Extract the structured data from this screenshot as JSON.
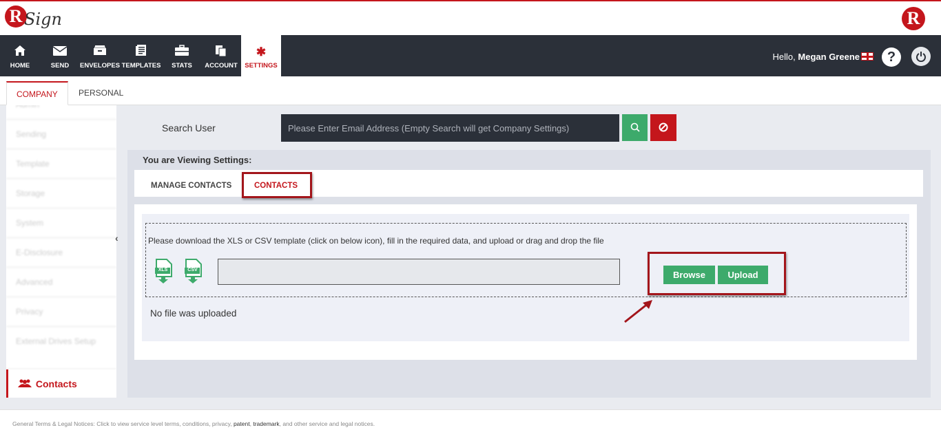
{
  "brand": {
    "logo_letter": "R",
    "logo_text": "Sign",
    "logo_right_letter": "R"
  },
  "nav": {
    "items": [
      {
        "label": "HOME",
        "icon": "home-icon"
      },
      {
        "label": "SEND",
        "icon": "envelope-icon"
      },
      {
        "label": "ENVELOPES",
        "icon": "inbox-icon"
      },
      {
        "label": "TEMPLATES",
        "icon": "document-icon"
      },
      {
        "label": "STATS",
        "icon": "briefcase-icon"
      },
      {
        "label": "ACCOUNT",
        "icon": "files-icon"
      },
      {
        "label": "SETTINGS",
        "icon": "gear-icon"
      }
    ],
    "active": "SETTINGS",
    "greeting": "Hello,",
    "user_name": "Megan Greene",
    "help_glyph": "?"
  },
  "tabs": [
    {
      "label": "COMPANY"
    },
    {
      "label": "PERSONAL"
    }
  ],
  "sidebar": {
    "items": [
      {
        "label": "Admin"
      },
      {
        "label": "Sending"
      },
      {
        "label": "Template"
      },
      {
        "label": "Storage"
      },
      {
        "label": "System"
      },
      {
        "label": "E-Disclosure"
      },
      {
        "label": "Advanced"
      },
      {
        "label": "Privacy"
      },
      {
        "label": "External Drives Setup"
      },
      {
        "label": "Contacts"
      }
    ],
    "active": "Contacts"
  },
  "search": {
    "label": "Search User",
    "placeholder": "Please Enter Email Address (Empty Search will get Company Settings)"
  },
  "panel": {
    "viewing_label": "You are Viewing Settings:",
    "subtabs": [
      {
        "label": "MANAGE CONTACTS"
      },
      {
        "label": "CONTACTS"
      }
    ],
    "active_subtab": "CONTACTS",
    "instructions": "Please download the XLS or CSV template (click on below icon), fill in the required data, and upload or drag and drop the file",
    "templates": [
      {
        "label": "XLS"
      },
      {
        "label": "CSV"
      }
    ],
    "browse_label": "Browse",
    "upload_label": "Upload",
    "status": "No file was uploaded"
  },
  "footer": {
    "title": "General Terms & Legal Notices:",
    "text1": "Click to view service level terms, conditions, privacy,",
    "link1": "patent",
    "sep": ",",
    "link2": "trademark",
    "text2": ", and other service and legal notices."
  },
  "colors": {
    "brand_red": "#c4161c",
    "navbar_bg": "#2b3039",
    "success_green": "#3daa6b"
  }
}
